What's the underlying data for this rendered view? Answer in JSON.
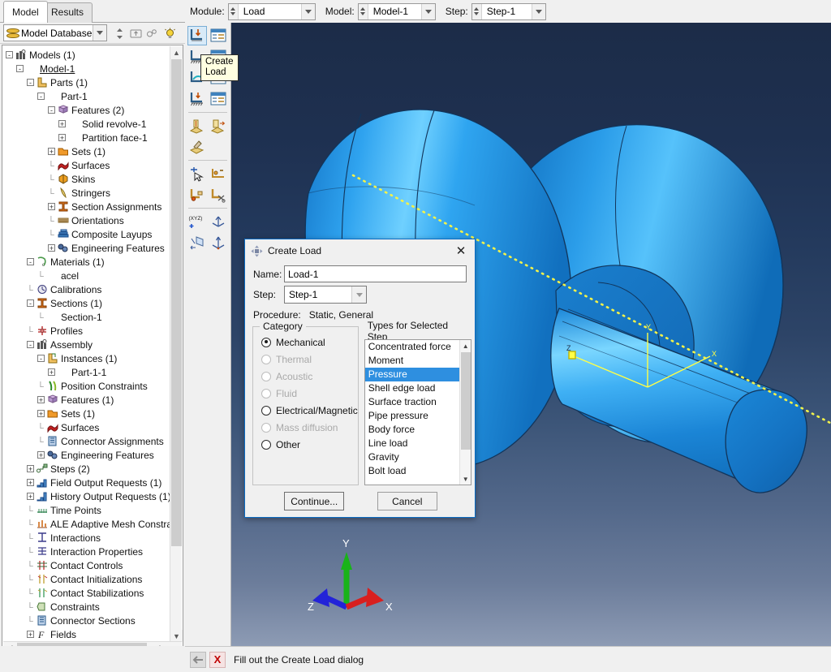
{
  "left_panel": {
    "tabs": [
      {
        "label": "Model",
        "active": true
      },
      {
        "label": "Results",
        "active": false
      }
    ],
    "database_combo": {
      "value": "Model Database",
      "icon": "database-icon"
    },
    "toolbar_icons": [
      "spinner-icon",
      "up-folder-icon",
      "link-icon",
      "bulb-icon"
    ],
    "tree": [
      {
        "depth": 0,
        "exp": "-",
        "icon": "models-icon",
        "label": "Models (1)"
      },
      {
        "depth": 1,
        "exp": "-",
        "icon": "model-icon",
        "label": "Model-1",
        "underline": true
      },
      {
        "depth": 2,
        "exp": "-",
        "icon": "parts-icon",
        "label": "Parts (1)"
      },
      {
        "depth": 3,
        "exp": "-",
        "icon": "none",
        "label": "Part-1"
      },
      {
        "depth": 4,
        "exp": "-",
        "icon": "features-icon",
        "label": "Features (2)"
      },
      {
        "depth": 5,
        "exp": "+",
        "icon": "none",
        "label": "Solid revolve-1"
      },
      {
        "depth": 5,
        "exp": "+",
        "icon": "none",
        "label": "Partition face-1"
      },
      {
        "depth": 4,
        "exp": "+",
        "icon": "sets-icon",
        "label": "Sets (1)"
      },
      {
        "depth": 4,
        "exp": "",
        "icon": "surfaces-icon",
        "label": "Surfaces"
      },
      {
        "depth": 4,
        "exp": "",
        "icon": "skins-icon",
        "label": "Skins"
      },
      {
        "depth": 4,
        "exp": "",
        "icon": "stringers-icon",
        "label": "Stringers"
      },
      {
        "depth": 4,
        "exp": "+",
        "icon": "section-assign-icon",
        "label": "Section Assignments"
      },
      {
        "depth": 4,
        "exp": "",
        "icon": "orientations-icon",
        "label": "Orientations"
      },
      {
        "depth": 4,
        "exp": "",
        "icon": "composite-icon",
        "label": "Composite Layups"
      },
      {
        "depth": 4,
        "exp": "+",
        "icon": "eng-features-icon",
        "label": "Engineering Features"
      },
      {
        "depth": 2,
        "exp": "-",
        "icon": "materials-icon",
        "label": "Materials (1)"
      },
      {
        "depth": 3,
        "exp": "",
        "icon": "none",
        "label": "acel"
      },
      {
        "depth": 2,
        "exp": "",
        "icon": "calibrations-icon",
        "label": "Calibrations"
      },
      {
        "depth": 2,
        "exp": "-",
        "icon": "sections-icon",
        "label": "Sections (1)"
      },
      {
        "depth": 3,
        "exp": "",
        "icon": "none",
        "label": "Section-1"
      },
      {
        "depth": 2,
        "exp": "",
        "icon": "profiles-icon",
        "label": "Profiles"
      },
      {
        "depth": 2,
        "exp": "-",
        "icon": "assembly-icon",
        "label": "Assembly"
      },
      {
        "depth": 3,
        "exp": "-",
        "icon": "instances-icon",
        "label": "Instances (1)"
      },
      {
        "depth": 4,
        "exp": "+",
        "icon": "none",
        "label": "Part-1-1"
      },
      {
        "depth": 3,
        "exp": "",
        "icon": "position-icon",
        "label": "Position Constraints"
      },
      {
        "depth": 3,
        "exp": "+",
        "icon": "features-icon",
        "label": "Features (1)"
      },
      {
        "depth": 3,
        "exp": "+",
        "icon": "sets-icon",
        "label": "Sets (1)"
      },
      {
        "depth": 3,
        "exp": "",
        "icon": "surfaces-icon",
        "label": "Surfaces"
      },
      {
        "depth": 3,
        "exp": "",
        "icon": "connector-assign-icon",
        "label": "Connector Assignments"
      },
      {
        "depth": 3,
        "exp": "+",
        "icon": "eng-features-icon",
        "label": "Engineering Features"
      },
      {
        "depth": 2,
        "exp": "+",
        "icon": "steps-icon",
        "label": "Steps (2)"
      },
      {
        "depth": 2,
        "exp": "+",
        "icon": "field-output-icon",
        "label": "Field Output Requests (1)"
      },
      {
        "depth": 2,
        "exp": "+",
        "icon": "history-output-icon",
        "label": "History Output Requests (1)"
      },
      {
        "depth": 2,
        "exp": "",
        "icon": "time-points-icon",
        "label": "Time Points"
      },
      {
        "depth": 2,
        "exp": "",
        "icon": "ale-icon",
        "label": "ALE Adaptive Mesh Constrai"
      },
      {
        "depth": 2,
        "exp": "",
        "icon": "interactions-icon",
        "label": "Interactions"
      },
      {
        "depth": 2,
        "exp": "",
        "icon": "interaction-prop-icon",
        "label": "Interaction Properties"
      },
      {
        "depth": 2,
        "exp": "",
        "icon": "contact-controls-icon",
        "label": "Contact Controls"
      },
      {
        "depth": 2,
        "exp": "",
        "icon": "contact-init-icon",
        "label": "Contact Initializations"
      },
      {
        "depth": 2,
        "exp": "",
        "icon": "contact-stab-icon",
        "label": "Contact Stabilizations"
      },
      {
        "depth": 2,
        "exp": "",
        "icon": "constraints-icon",
        "label": "Constraints"
      },
      {
        "depth": 2,
        "exp": "",
        "icon": "connector-sections-icon",
        "label": "Connector Sections"
      },
      {
        "depth": 2,
        "exp": "+",
        "icon": "fields-icon",
        "label": "Fields"
      }
    ]
  },
  "context_bar": {
    "module": {
      "label": "Module:",
      "value": "Load"
    },
    "model": {
      "label": "Model:",
      "value": "Model-1"
    },
    "step": {
      "label": "Step:",
      "value": "Step-1"
    }
  },
  "toolbox": {
    "tooltip": "Create\nLoad",
    "tooltip_line1": "Create",
    "tooltip_line2": "Load",
    "buttons": [
      "create-load-icon",
      "load-manager-icon",
      "create-bc-icon",
      "bc-manager-icon",
      "create-predefined-field-icon",
      "field-manager-icon",
      "create-load-case-icon",
      "load-case-manager-icon",
      "create-amplitude-icon",
      "amplitude-manager-icon",
      "edit-amplitude-icon",
      "create-set-icon",
      "create-surface-icon",
      "create-display-group-icon",
      "cut-icon",
      "create-datum-csys-icon",
      "create-datum-point-icon",
      "create-datum-plane-icon",
      "create-datum-axis-icon"
    ]
  },
  "dialog": {
    "title": "Create Load",
    "icon": "load-icon",
    "close_label": "✕",
    "name_label": "Name:",
    "name_value": "Load-1",
    "step_label": "Step:",
    "step_value": "Step-1",
    "procedure_label": "Procedure:",
    "procedure_value": "Static, General",
    "category_legend": "Category",
    "types_legend": "Types for Selected Step",
    "categories": [
      {
        "label": "Mechanical",
        "selected": true,
        "disabled": false
      },
      {
        "label": "Thermal",
        "selected": false,
        "disabled": true
      },
      {
        "label": "Acoustic",
        "selected": false,
        "disabled": true
      },
      {
        "label": "Fluid",
        "selected": false,
        "disabled": true
      },
      {
        "label": "Electrical/Magnetic",
        "selected": false,
        "disabled": false
      },
      {
        "label": "Mass diffusion",
        "selected": false,
        "disabled": true
      },
      {
        "label": "Other",
        "selected": false,
        "disabled": false
      }
    ],
    "types": [
      {
        "label": "Concentrated force",
        "selected": false
      },
      {
        "label": "Moment",
        "selected": false
      },
      {
        "label": "Pressure",
        "selected": true
      },
      {
        "label": "Shell edge load",
        "selected": false
      },
      {
        "label": "Surface traction",
        "selected": false
      },
      {
        "label": "Pipe pressure",
        "selected": false
      },
      {
        "label": "Body force",
        "selected": false
      },
      {
        "label": "Line load",
        "selected": false
      },
      {
        "label": "Gravity",
        "selected": false
      },
      {
        "label": "Bolt load",
        "selected": false
      }
    ],
    "continue_label": "Continue...",
    "cancel_label": "Cancel",
    "accent_color": "#0a6cc4",
    "selection_color": "#2e8fe0"
  },
  "viewport": {
    "triad": {
      "x_label": "X",
      "y_label": "Y",
      "z_label": "Z",
      "x_color": "#d81f1f",
      "y_color": "#19b319",
      "z_color": "#2323d8"
    },
    "datum_csys": {
      "x_label": "X",
      "y_label": "Y",
      "z_label": "Z",
      "color": "#ffff00"
    },
    "model_color": "#1d8fe0",
    "background_top": "#1c2c48",
    "background_bottom": "#8d9bb4"
  },
  "prompt_bar": {
    "back_icon": "back-arrow-icon",
    "cancel_icon": "cancel-x-icon",
    "cancel_glyph": "X",
    "text": "Fill out the Create Load dialog"
  }
}
